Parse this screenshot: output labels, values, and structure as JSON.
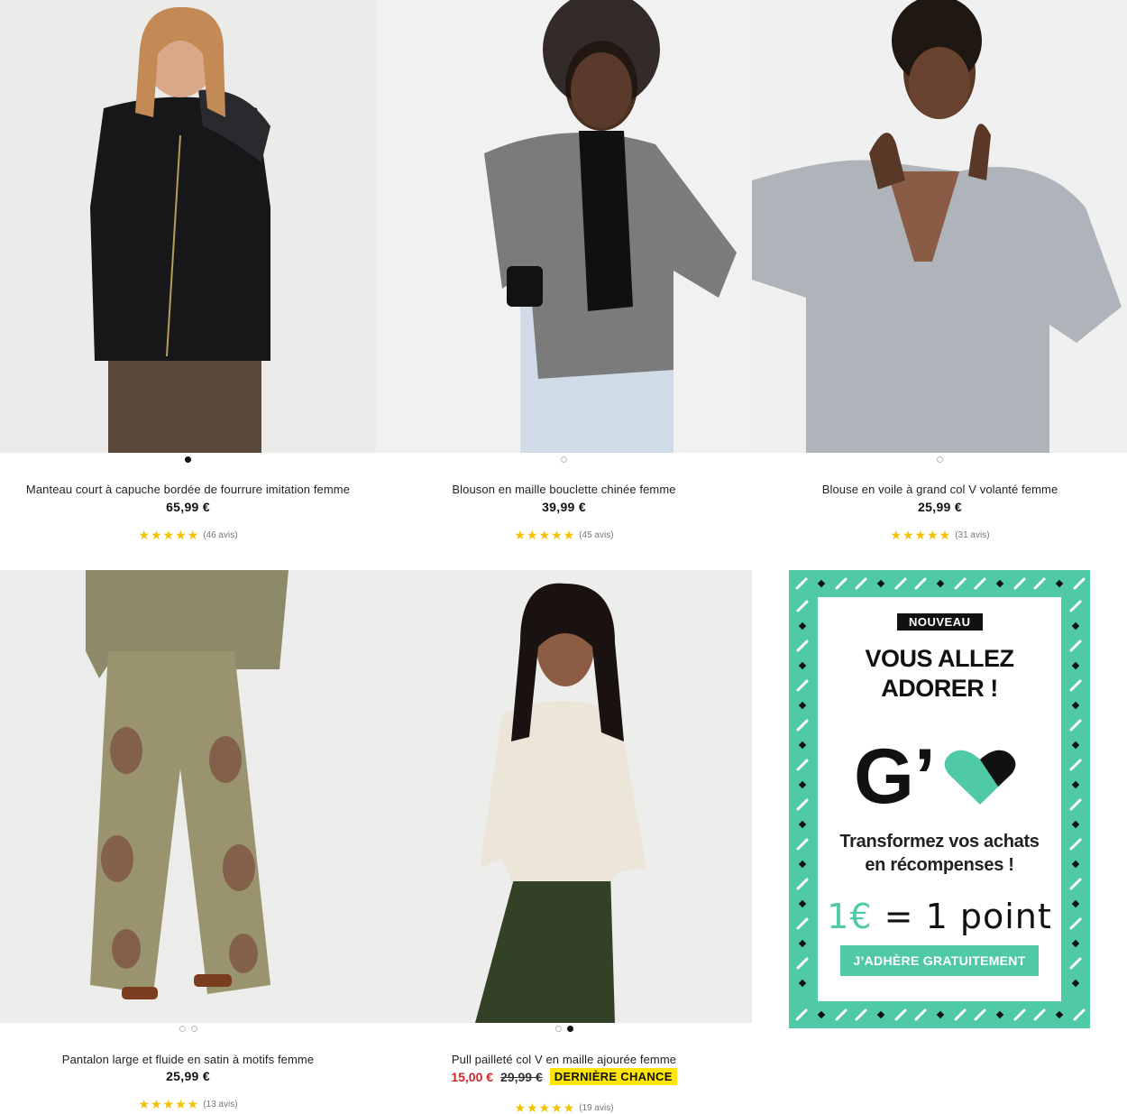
{
  "products": [
    {
      "title": "Manteau court à capuche bordée de fourrure imitation femme",
      "price": "65,99 €",
      "reviews": "(46 avis)",
      "stars": "★★★★★",
      "rating": 4.5,
      "image_icon": "coat-photo"
    },
    {
      "title": "Blouson en maille bouclette chinée femme",
      "price": "39,99 €",
      "reviews": "(45 avis)",
      "stars": "★★★★★",
      "rating": 4.5,
      "image_icon": "jacket-photo"
    },
    {
      "title": "Blouse en voile à grand col V volanté femme",
      "price": "25,99 €",
      "reviews": "(31 avis)",
      "stars": "★★★★★",
      "rating": 4.5,
      "image_icon": "blouse-photo"
    },
    {
      "title": "Pantalon large et fluide en satin à motifs femme",
      "price": "25,99 €",
      "reviews": "(13 avis)",
      "stars": "★★★★★",
      "rating": 5,
      "image_icon": "trousers-photo"
    },
    {
      "title": "Pull pailleté col V en maille ajourée femme",
      "sale_price": "15,00 €",
      "old_price": "29,99 €",
      "badge": "DERNIÈRE CHANCE",
      "reviews": "(19 avis)",
      "stars": "★★★★★",
      "rating": 4.5,
      "image_icon": "sweater-photo"
    }
  ],
  "promo": {
    "badge": "NOUVEAU",
    "headline_1": "VOUS ALLEZ",
    "headline_2": "ADORER !",
    "logo_text": "G’",
    "sub_1": "Transformez vos achats",
    "sub_2": "en récompenses !",
    "points_euro": "1€",
    "points_rest": " = 1 point",
    "cta": "J’ADHÈRE GRATUITEMENT"
  },
  "colors": {
    "accent": "#4fc9a6",
    "star": "#f2c200",
    "sale": "#d8232a",
    "badge": "#ffe500"
  }
}
